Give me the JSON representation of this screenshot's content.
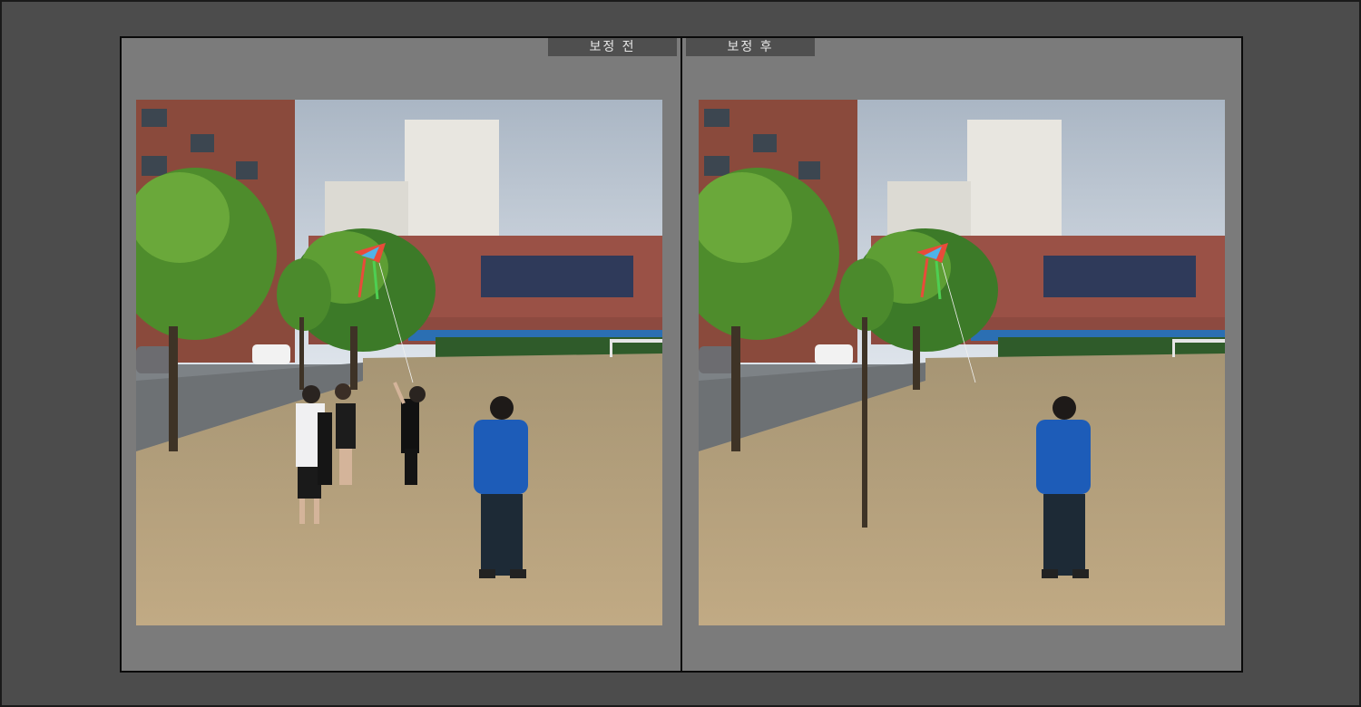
{
  "compare": {
    "before_label": "보정 전",
    "after_label": "보정 후"
  },
  "colors": {
    "background": "#4c4c4c",
    "frame": "#7b7b7b",
    "label_tab": "#4f4f4f"
  },
  "icons": {
    "before_photo": "schoolyard-photo",
    "after_photo": "schoolyard-photo"
  }
}
